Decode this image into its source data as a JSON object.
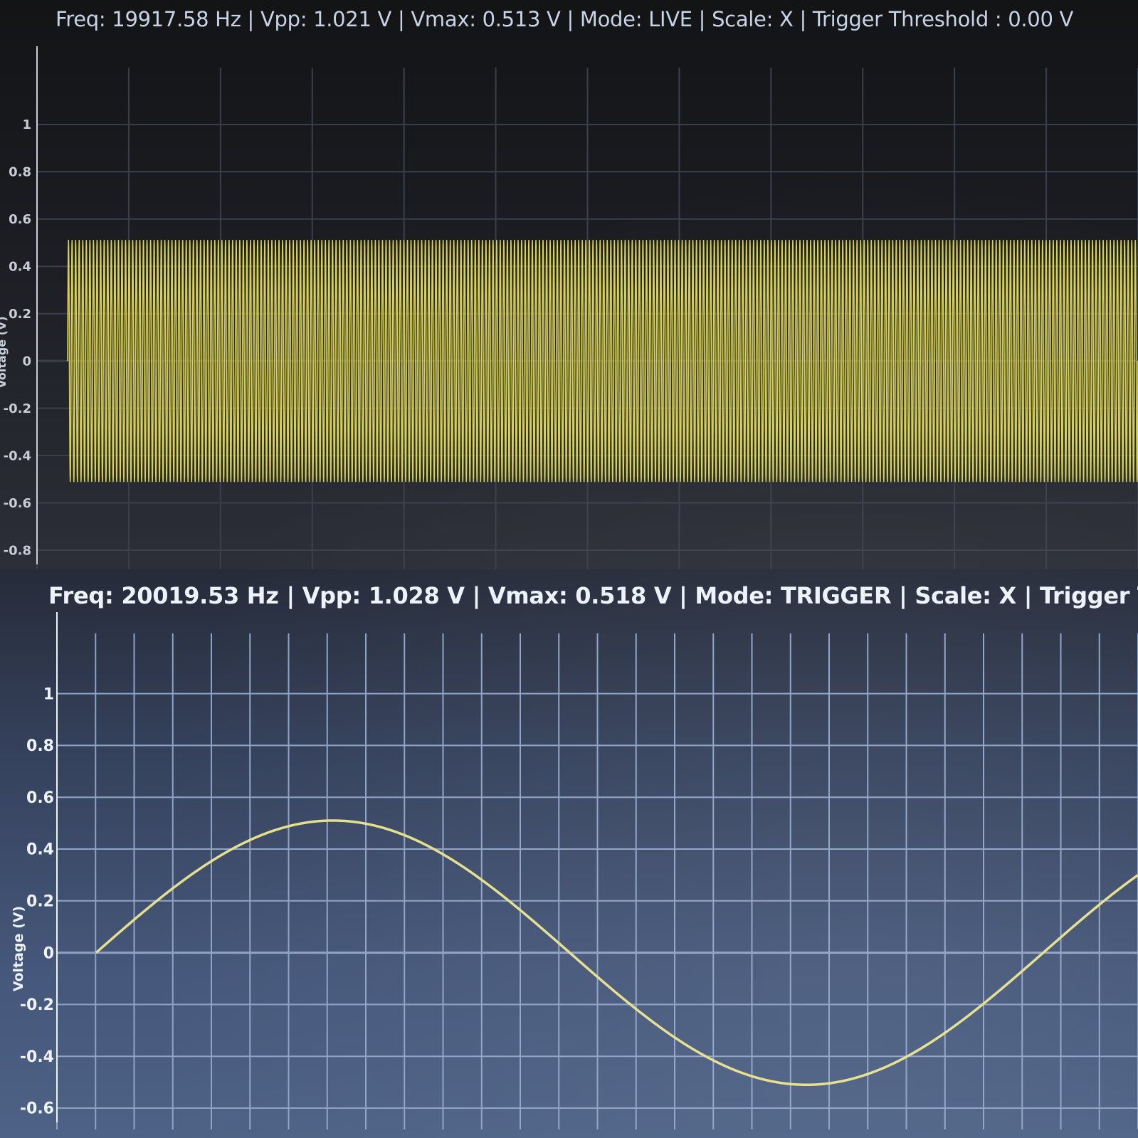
{
  "top_panel": {
    "status": {
      "freq": "Freq: 19917.58 Hz",
      "vpp": "Vpp: 1.021 V",
      "vmax": "Vmax: 0.513 V",
      "mode": "Mode: LIVE",
      "scale": "Scale: X",
      "trigger": "Trigger Threshold : 0.00 V",
      "separator": " | "
    },
    "y_axis_label": "Voltage (V)"
  },
  "bottom_panel": {
    "status": {
      "freq": "Freq: 20019.53 Hz",
      "vpp": "Vpp: 1.028 V",
      "vmax": "Vmax: 0.518 V",
      "mode": "Mode: TRIGGER",
      "scale": "Scale: X",
      "trigger": "Trigger Thres",
      "separator": " | "
    },
    "y_axis_label": "Voltage (V)"
  },
  "colors": {
    "trace": "#d9d24a",
    "trace_bottom": "#e4e08a",
    "grid_top": "#3a3f4c",
    "grid_bottom": "#8fa3c6",
    "axis_text_top": "#c8cdd8",
    "axis_text_bottom": "#eef2fa"
  },
  "chart_data": [
    {
      "type": "line",
      "mode": "LIVE",
      "ylabel": "Voltage (V)",
      "yticks": [
        "1",
        "0.8",
        "0.6",
        "0.4",
        "0.2",
        "0",
        "-0.2",
        "-0.4",
        "-0.6",
        "-0.8"
      ],
      "ytick_values": [
        1,
        0.8,
        0.6,
        0.4,
        0.2,
        0,
        -0.2,
        -0.4,
        -0.6,
        -0.8
      ],
      "ylim": [
        -0.8,
        1.15
      ],
      "signal": {
        "amplitude": 0.51,
        "offset": 0.0,
        "cycles_shown": 300,
        "shape": "sine"
      },
      "grid": true
    },
    {
      "type": "line",
      "mode": "TRIGGER",
      "ylabel": "Voltage (V)",
      "yticks": [
        "1",
        "0.8",
        "0.6",
        "0.4",
        "0.2",
        "0",
        "-0.2",
        "-0.4",
        "-0.6"
      ],
      "ytick_values": [
        1,
        0.8,
        0.6,
        0.4,
        0.2,
        0,
        -0.2,
        -0.4,
        -0.6
      ],
      "ylim": [
        -0.6,
        1.15
      ],
      "signal": {
        "amplitude": 0.51,
        "offset": 0.0,
        "cycles_shown": 1.1,
        "phase_start": 0.0,
        "shape": "sine"
      },
      "grid": true
    }
  ]
}
